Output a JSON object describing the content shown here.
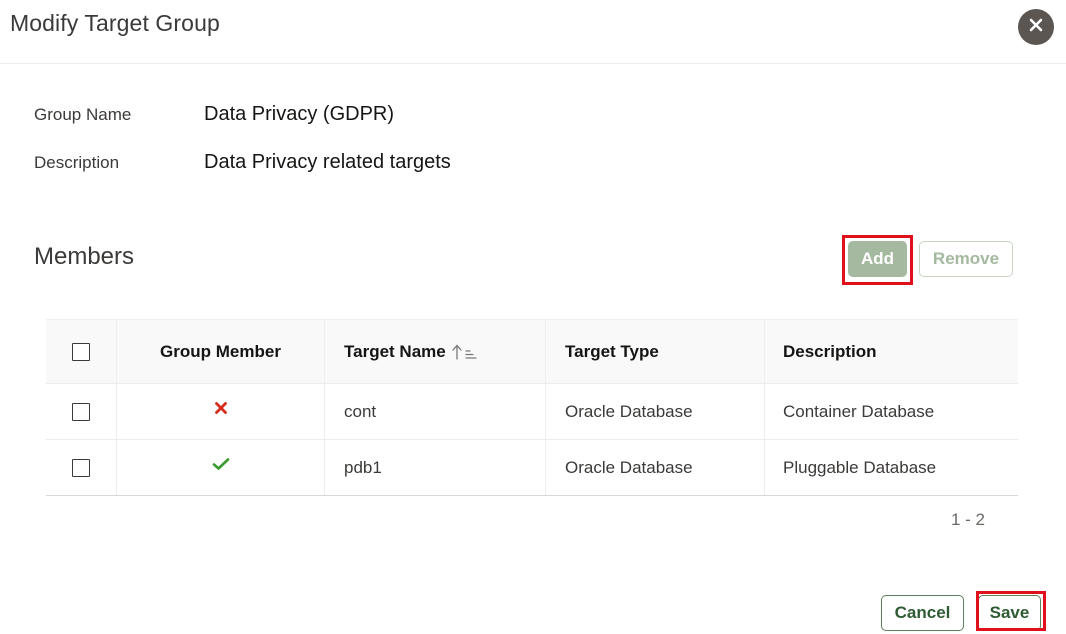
{
  "dialog": {
    "title": "Modify Target Group",
    "close_icon": "close-icon"
  },
  "form": {
    "group_name_label": "Group Name",
    "group_name_value": "Data Privacy (GDPR)",
    "description_label": "Description",
    "description_value": "Data Privacy related targets"
  },
  "members": {
    "title": "Members",
    "add_label": "Add",
    "remove_label": "Remove",
    "columns": [
      "Group Member",
      "Target Name",
      "Target Type",
      "Description"
    ],
    "sort_icon": "sort-ascending-icon",
    "rows": [
      {
        "member_status": "not-member",
        "member_icon": "cross-icon",
        "target_name": "cont",
        "target_type": "Oracle Database",
        "description": "Container Database"
      },
      {
        "member_status": "member",
        "member_icon": "check-icon",
        "target_name": "pdb1",
        "target_type": "Oracle Database",
        "description": "Pluggable Database"
      }
    ],
    "pagination": "1 - 2"
  },
  "footer": {
    "cancel_label": "Cancel",
    "save_label": "Save"
  },
  "colors": {
    "accent_green": "#2f5b33",
    "disabled_green": "#a4b99f",
    "highlight_red": "#e0101c",
    "cross_red": "#d62c1a",
    "check_green": "#3a9a2f"
  }
}
